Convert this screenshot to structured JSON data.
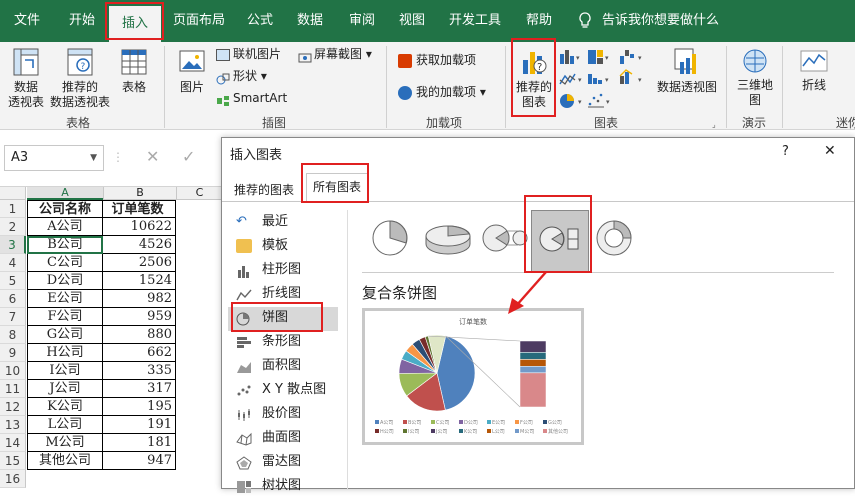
{
  "menu": {
    "tabs": [
      "文件",
      "开始",
      "插入",
      "页面布局",
      "公式",
      "数据",
      "审阅",
      "视图",
      "开发工具",
      "帮助"
    ],
    "tell_me": "告诉我你想要做什么"
  },
  "ribbon": {
    "pivot_table": "数据\n透视表",
    "recommended_pivot": "推荐的\n数据透视表",
    "table": "表格",
    "group_tables": "表格",
    "pictures": "图片",
    "online_pictures": "联机图片",
    "shapes": "形状",
    "smartart": "SmartArt",
    "screenshot": "屏幕截图",
    "group_illustrations": "插图",
    "get_addins": "获取加载项",
    "my_addins": "我的加载项",
    "group_addins": "加载项",
    "recommended_charts": "推荐的\n图表",
    "pivot_chart": "数据透视图",
    "group_charts": "图表",
    "map_3d": "三维地\n图",
    "group_tours": "演示",
    "sparkline_line": "折线",
    "group_sparklines": "迷你"
  },
  "formula_bar": {
    "name_box": "A3",
    "cancel": "✕",
    "enter": "✓"
  },
  "sheet": {
    "col_headers": [
      "A",
      "B",
      "C"
    ],
    "rows": [
      {
        "n": "1",
        "a": "公司名称",
        "b": "订单笔数"
      },
      {
        "n": "2",
        "a": "A公司",
        "b": "10622"
      },
      {
        "n": "3",
        "a": "B公司",
        "b": "4526"
      },
      {
        "n": "4",
        "a": "C公司",
        "b": "2506"
      },
      {
        "n": "5",
        "a": "D公司",
        "b": "1524"
      },
      {
        "n": "6",
        "a": "E公司",
        "b": "982"
      },
      {
        "n": "7",
        "a": "F公司",
        "b": "959"
      },
      {
        "n": "8",
        "a": "G公司",
        "b": "880"
      },
      {
        "n": "9",
        "a": "H公司",
        "b": "662"
      },
      {
        "n": "10",
        "a": "I公司",
        "b": "335"
      },
      {
        "n": "11",
        "a": "J公司",
        "b": "317"
      },
      {
        "n": "12",
        "a": "K公司",
        "b": "195"
      },
      {
        "n": "13",
        "a": "L公司",
        "b": "191"
      },
      {
        "n": "14",
        "a": "M公司",
        "b": "181"
      },
      {
        "n": "15",
        "a": "其他公司",
        "b": "947"
      },
      {
        "n": "16",
        "a": "",
        "b": ""
      }
    ]
  },
  "dialog": {
    "title": "插入图表",
    "help": "?",
    "close": "✕",
    "tab_recommended": "推荐的图表",
    "tab_all": "所有图表",
    "chart_types": [
      "最近",
      "模板",
      "柱形图",
      "折线图",
      "饼图",
      "条形图",
      "面积图",
      "X Y 散点图",
      "股价图",
      "曲面图",
      "雷达图",
      "树状图"
    ],
    "selected_subtype_title": "复合条饼图",
    "preview_title": "订单笔数",
    "legend": [
      "A公司",
      "B公司",
      "C公司",
      "D公司",
      "E公司",
      "F公司",
      "G公司",
      "H公司",
      "I公司",
      "J公司",
      "K公司",
      "L公司",
      "M公司",
      "其他公司"
    ]
  },
  "colors": {
    "excel_green": "#217346",
    "highlight_red": "#e02020",
    "pie": [
      "#4f81bd",
      "#c0504d",
      "#9bbb59",
      "#8064a2",
      "#4bacc6",
      "#f79646",
      "#2c4d75",
      "#772c2a",
      "#5f7530",
      "#4d3b62",
      "#276a7c",
      "#b65708",
      "#729aca",
      "#d9888a"
    ]
  }
}
